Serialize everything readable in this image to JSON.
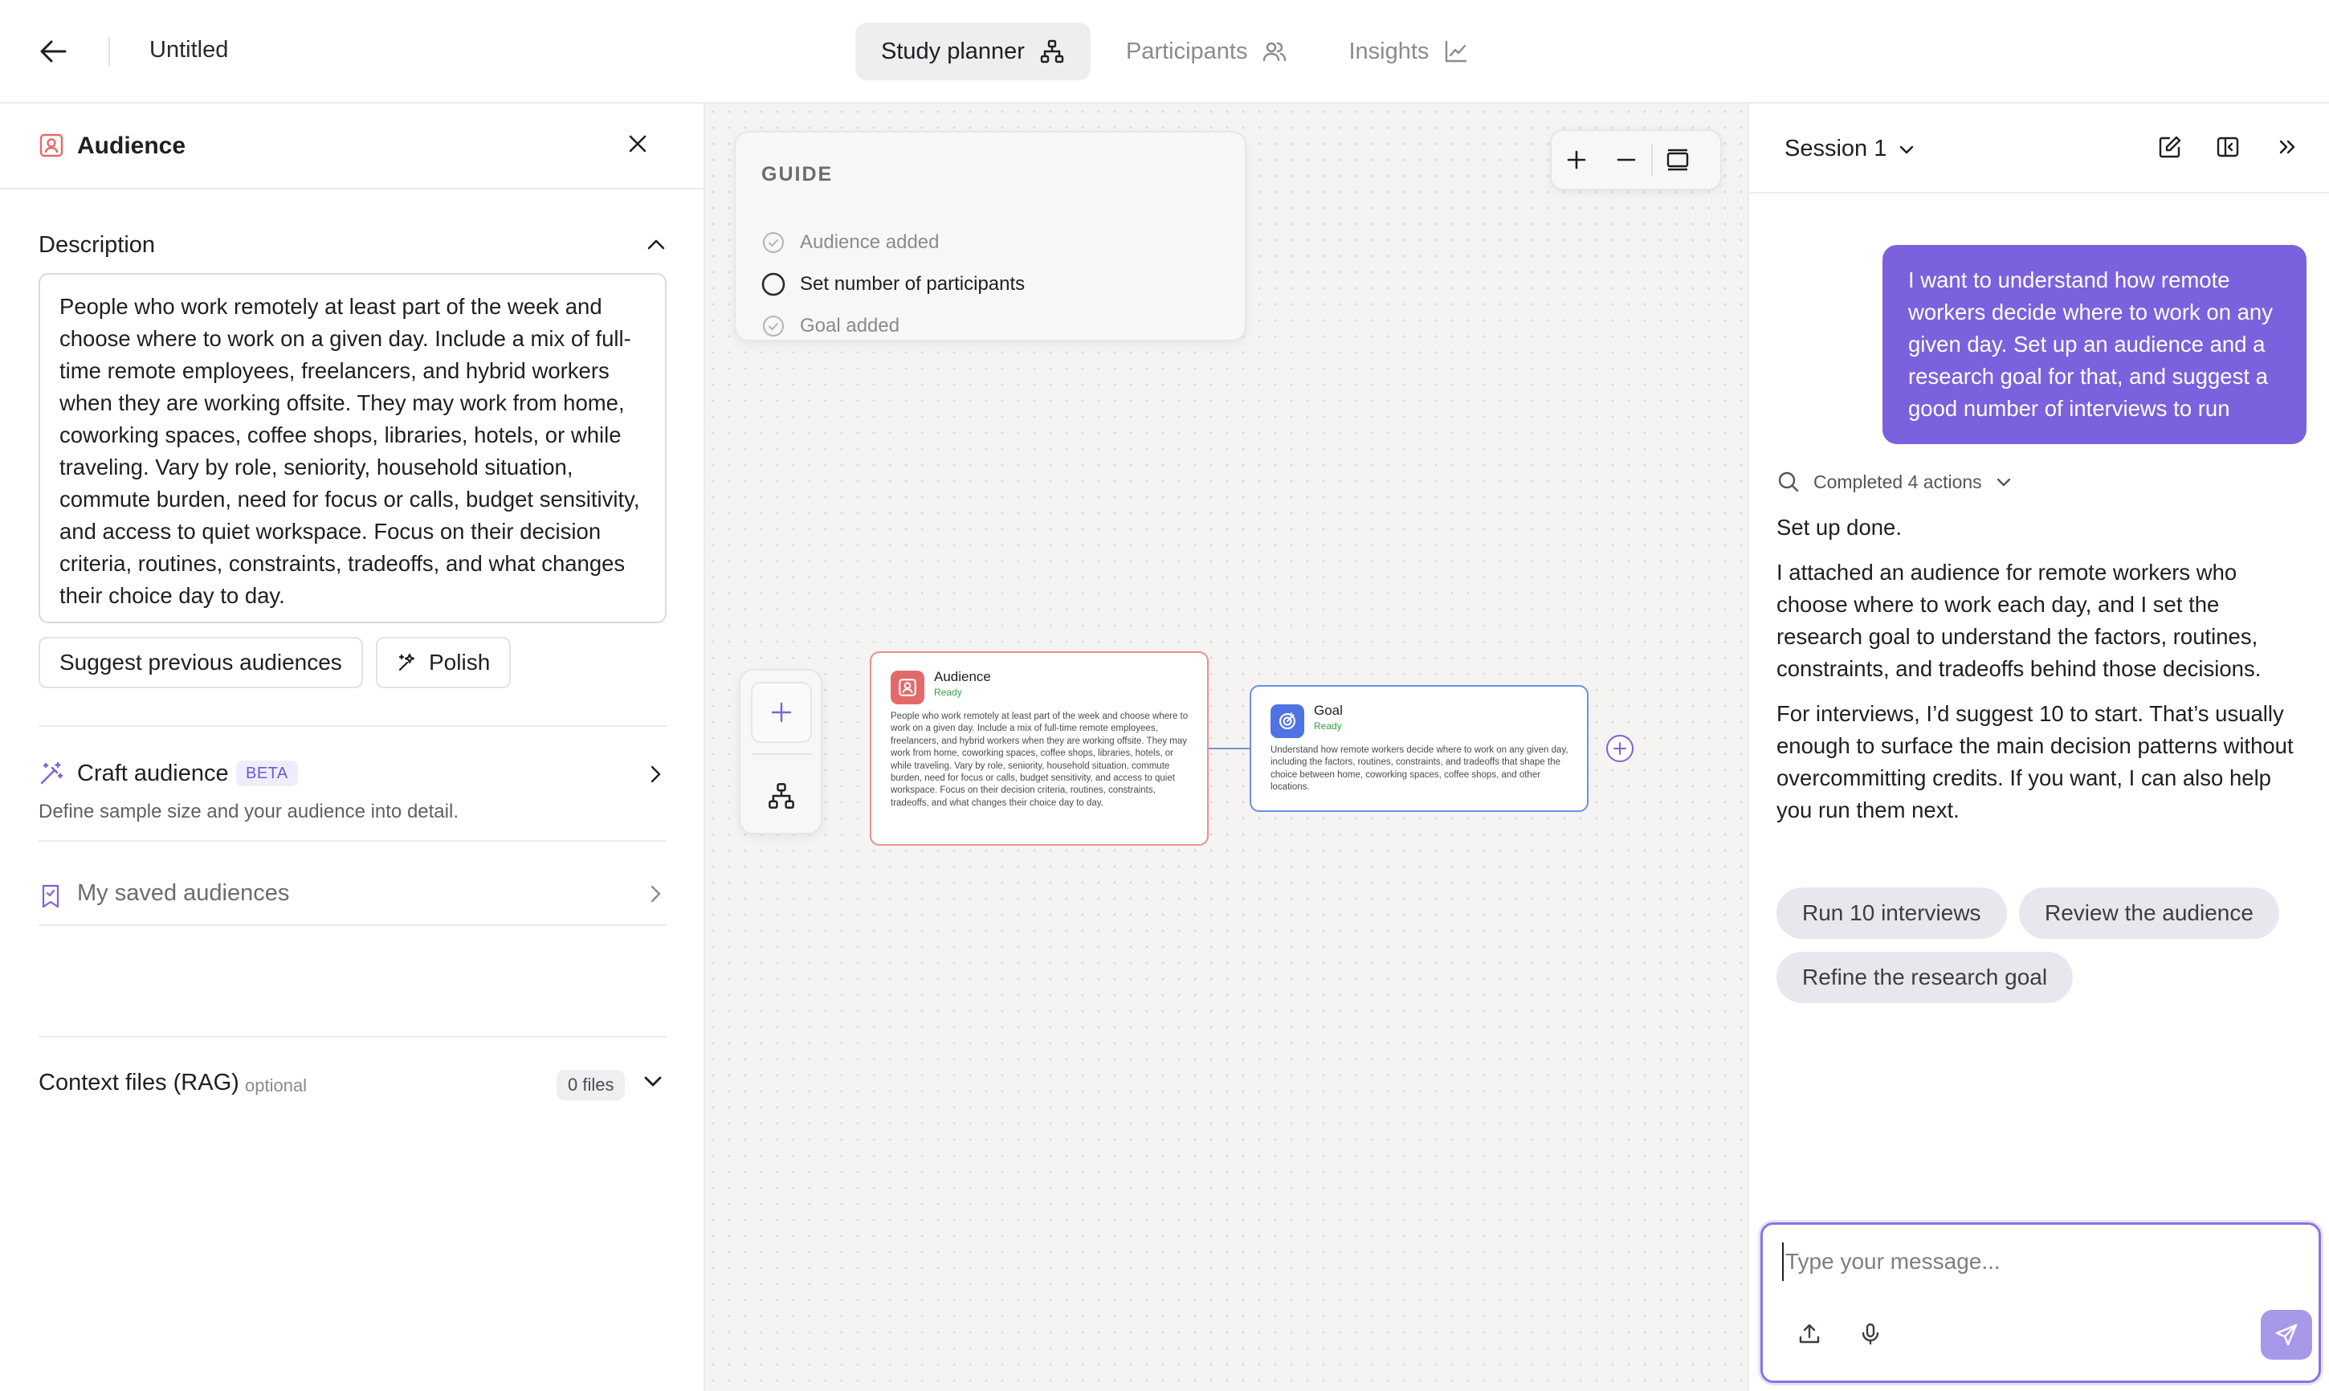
{
  "header": {
    "title": "Untitled",
    "tabs": [
      {
        "label": "Study planner",
        "icon": "sitemap-icon",
        "active": true
      },
      {
        "label": "Participants",
        "icon": "users-icon",
        "active": false
      },
      {
        "label": "Insights",
        "icon": "chart-icon",
        "active": false
      }
    ]
  },
  "left_panel": {
    "title": "Audience",
    "description_label": "Description",
    "description_text": "People who work remotely at least part of the week and choose where to work on a given day. Include a mix of full-time remote employees, freelancers, and hybrid workers when they are working offsite. They may work from home, coworking spaces, coffee shops, libraries, hotels, or while traveling. Vary by role, seniority, household situation, commute burden, need for focus or calls, budget sensitivity, and access to quiet workspace. Focus on their decision criteria, routines, constraints, tradeoffs, and what changes their choice day to day.",
    "suggest_label": "Suggest previous audiences",
    "polish_label": "Polish",
    "craft_title": "Craft audience",
    "craft_badge": "BETA",
    "craft_subtitle": "Define sample size and your audience into detail.",
    "saved_label": "My saved audiences",
    "context_label": "Context files (RAG)",
    "context_optional": "optional",
    "files_count": "0 files"
  },
  "canvas": {
    "guide_title": "GUIDE",
    "guide_items": [
      {
        "label": "Audience added",
        "done": true
      },
      {
        "label": "Set number of participants",
        "done": false
      },
      {
        "label": "Goal added",
        "done": true
      }
    ],
    "audience_node": {
      "title": "Audience",
      "status": "Ready",
      "text": "People who work remotely at least part of the week and choose where to work on a given day. Include a mix of full-time remote employees, freelancers, and hybrid workers when they are working offsite. They may work from home, coworking spaces, coffee shops, libraries, hotels, or while traveling. Vary by role, seniority, household situation, commute burden, need for focus or calls, budget sensitivity, and access to quiet workspace. Focus on their decision criteria, routines, constraints, tradeoffs, and what changes their choice day to day."
    },
    "goal_node": {
      "title": "Goal",
      "status": "Ready",
      "text": "Understand how remote workers decide where to work on any given day, including the factors, routines, constraints, and tradeoffs that shape the choice between home, coworking spaces, coffee shops, and other locations."
    }
  },
  "chat": {
    "session_label": "Session 1",
    "user_message": "I want to understand how remote workers decide where to work on any given day. Set up an audience and a research goal for that, and suggest a good number of interviews to run",
    "actions_label": "Completed 4 actions",
    "response": [
      "Set up done.",
      "I attached an audience for remote workers who choose where to work each day, and I set the research goal to understand the factors, routines, constraints, and tradeoffs behind those decisions.",
      "For interviews, I’d suggest 10 to start. That’s usually enough to surface the main decision patterns without overcommitting credits. If you want, I can also help you run them next."
    ],
    "suggestions": [
      "Run 10 interviews",
      "Review the audience",
      "Refine the research goal"
    ],
    "input_placeholder": "Type your message..."
  },
  "colors": {
    "accent": "#7b61dd",
    "audience": "#e46a6a",
    "goal": "#4f73e3",
    "ready": "#2fa14a"
  }
}
